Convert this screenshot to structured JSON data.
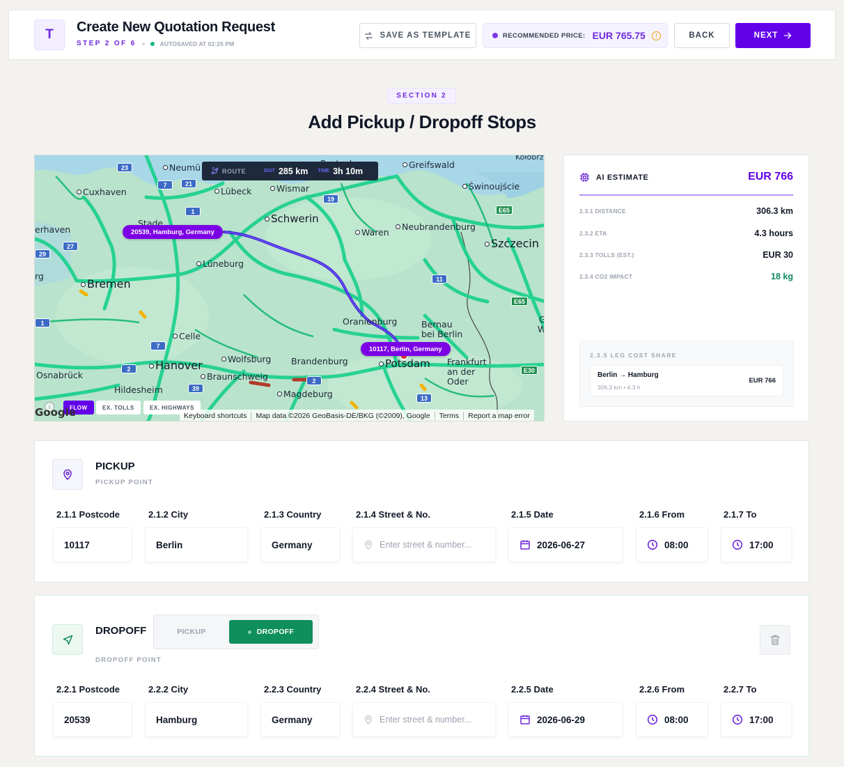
{
  "header": {
    "logo_letter": "T",
    "title": "Create New Quotation Request",
    "step_label": "STEP 2 OF 6",
    "autosave": "AUTOSAVED AT 02:25 PM",
    "save_template_label": "SAVE AS TEMPLATE",
    "recommended_label": "RECOMMENDED PRICE:",
    "recommended_value": "EUR 765.75",
    "warn_icon": "!",
    "back_label": "BACK",
    "next_label": "NEXT",
    "colors": {
      "accent": "#6200ea",
      "success": "#10b981",
      "warning": "#f59e0b"
    }
  },
  "section": {
    "badge": "SECTION 2",
    "title": "Add Pickup / Dropoff Stops"
  },
  "map": {
    "route_label": "ROUTE",
    "distance_key": "DIST",
    "distance": "285 km",
    "time_key": "TIME",
    "time": "3h 10m",
    "origin_pill": "20539, Hamburg, Germany",
    "destination_pill": "10117, Berlin, Germany",
    "info_icon": "i",
    "tools": [
      "FLOW",
      "EX. TOLLS",
      "EX. HIGHWAYS"
    ],
    "google_logo": "Google",
    "footer": [
      "Keyboard shortcuts",
      "Map data ©2026 GeoBasis-DE/BKG (©2009), Google",
      "Terms",
      "Report a map error"
    ],
    "cities": {
      "neumunster": "Neumü",
      "rostock": "Rostock",
      "greifswald": "Greifswald",
      "cuxhaven": "Cuxhaven",
      "lubeck": "Lübeck",
      "wismar": "Wismar",
      "swinoujscie": "Świnoujście",
      "kolobrzeg": "Kołobrz",
      "stade": "Stade",
      "bremerhaven": "erhaven",
      "schwerin": "Schwerin",
      "waren": "Waren",
      "neubrandenburg": "Neubrandenburg",
      "szczecin": "Szczecin",
      "luneburg": "Lüneburg",
      "bremen": "Bremen",
      "oldenburg": "rg",
      "oranienburg": "Oranienburg",
      "bernau": "Bernau bei Berlin",
      "celle": "Celle",
      "hanover": "Hanover",
      "wolfsburg": "Wolfsburg",
      "brandenburg": "Brandenburg",
      "potsdam": "Potsdam",
      "frankfurt_oder": "Frankfurt an der Oder",
      "osnabruck": "Osnabrück",
      "braunschweig": "Braunschweig",
      "hildesheim": "Hildesheim",
      "magdeburg": "Magdeburg",
      "edge_g": "G",
      "edge_w": "W"
    },
    "highways": [
      "23",
      "7",
      "21",
      "1",
      "19",
      "27",
      "29",
      "11",
      "1",
      "7",
      "2",
      "39",
      "2",
      "13",
      "E65",
      "E65",
      "E30"
    ]
  },
  "estimate": {
    "title": "AI ESTIMATE",
    "total": "EUR 766",
    "rows": [
      {
        "key": "2.3.1 DISTANCE",
        "value": "306.3 km"
      },
      {
        "key": "2.3.2 ETA",
        "value": "4.3 hours"
      },
      {
        "key": "2.3.3 TOLLS (EST.)",
        "value": "EUR 30"
      },
      {
        "key": "2.3.4 CO2 IMPACT",
        "value": "18 kg"
      }
    ],
    "leg_title": "2.3.5 LEG COST SHARE",
    "leg_route": "Berlin → Hamburg",
    "leg_meta": "306.3 km • 4.3 h",
    "leg_cost": "EUR 766"
  },
  "pickup": {
    "title": "PICKUP",
    "subtitle": "PICKUP POINT",
    "labels": [
      "2.1.1 Postcode",
      "2.1.2 City",
      "2.1.3 Country",
      "2.1.4 Street & No.",
      "2.1.5 Date",
      "2.1.6 From",
      "2.1.7 To"
    ],
    "postcode": "10117",
    "city": "Berlin",
    "country": "Germany",
    "street_placeholder": "Enter street & number...",
    "date": "2026-06-27",
    "from": "08:00",
    "to": "17:00"
  },
  "dropoff": {
    "title": "DROPOFF",
    "subtitle": "DROPOFF POINT",
    "toggle_pickup": "PICKUP",
    "toggle_dropoff": "DROPOFF",
    "labels": [
      "2.2.1 Postcode",
      "2.2.2 City",
      "2.2.3 Country",
      "2.2.4 Street & No.",
      "2.2.5 Date",
      "2.2.6 From",
      "2.2.7 To"
    ],
    "postcode": "20539",
    "city": "Hamburg",
    "country": "Germany",
    "street_placeholder": "Enter street & number...",
    "date": "2026-06-29",
    "from": "08:00",
    "to": "17:00"
  }
}
